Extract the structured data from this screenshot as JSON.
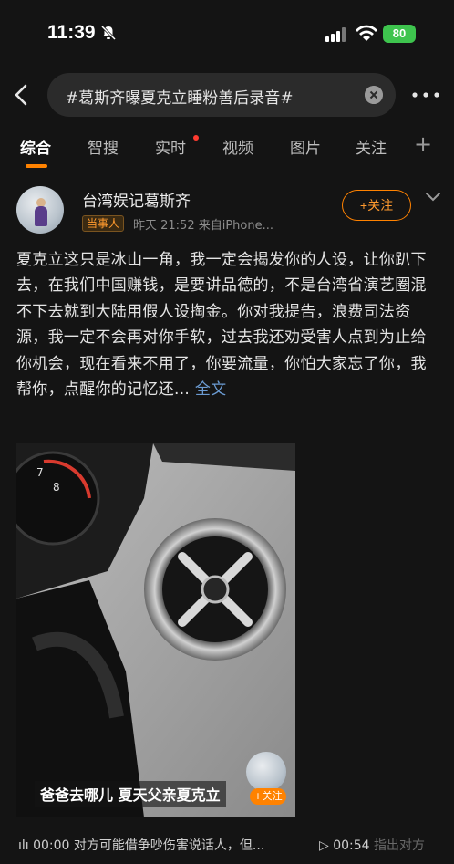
{
  "status_bar": {
    "time": "11:39",
    "battery": "80"
  },
  "search": {
    "query": "#葛斯齐曝夏克立睡粉善后录音#"
  },
  "tabs": [
    {
      "label": "综合",
      "active": true
    },
    {
      "label": "智搜"
    },
    {
      "label": "实时",
      "dot": true
    },
    {
      "label": "视频"
    },
    {
      "label": "图片"
    },
    {
      "label": "关注"
    }
  ],
  "post": {
    "author": "台湾娱记葛斯齐",
    "badge": "当事人",
    "meta": "昨天 21:52  来自iPhone...",
    "follow_label": "+关注",
    "body": "夏克立这只是冰山一角，我一定会揭发你的人设，让你趴下去，在我们中国赚钱，是要讲品德的，不是台湾省演艺圈混不下去就到大陆用假人设掏金。你对我提告，浪费司法资源，我一定不会再对你手软，过去我还劝受害人点到为止给你机会，现在看来不用了，你要流量，你怕大家忘了你，我帮你，点醒你的记忆还...",
    "full_text": " 全文",
    "video_caption": "爸爸去哪儿 夏天父亲夏克立",
    "video_follow": "+关注"
  },
  "audio": {
    "left": "ılı 00:00  对方可能借争吵伤害说话人，但...",
    "right_time": "▷ 00:54",
    "right_text": " 指出对方"
  }
}
